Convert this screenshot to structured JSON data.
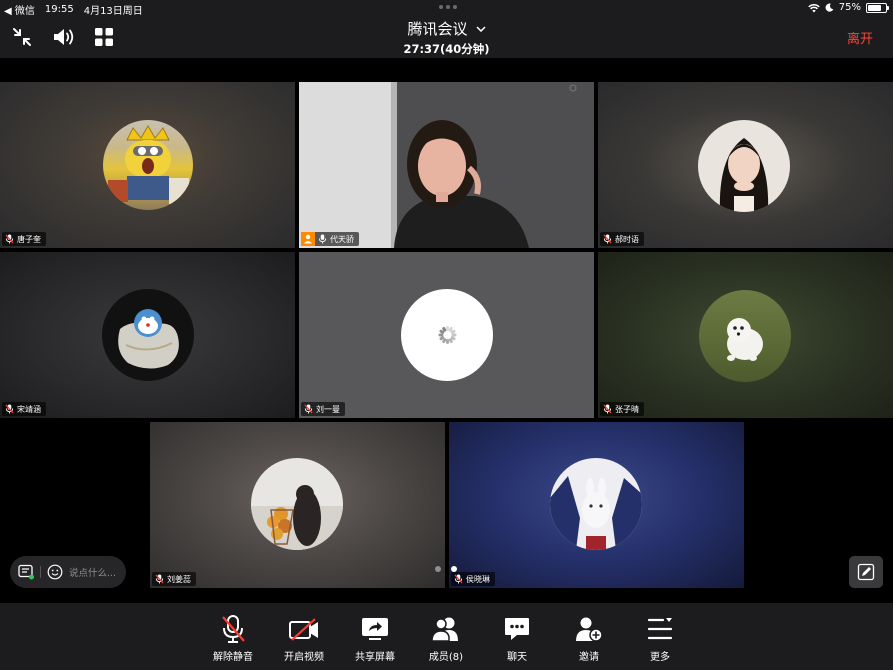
{
  "status_bar": {
    "back_app": "◀ 微信",
    "time": "19:55",
    "date": "4月13日周日",
    "battery": "75%",
    "battery_level": 0.75
  },
  "header": {
    "title": "腾讯会议",
    "duration": "27:37(40分钟)",
    "leave_label": "离开"
  },
  "participants": [
    {
      "name": "唐子奎"
    },
    {
      "name": "代天骄",
      "host": true
    },
    {
      "name": "郝时语"
    },
    {
      "name": "宋靖涵"
    },
    {
      "name": "刘一曼"
    },
    {
      "name": "张子晴"
    },
    {
      "name": "刘姜蕊"
    },
    {
      "name": "侯晓琳"
    }
  ],
  "chat": {
    "placeholder": "说点什么..."
  },
  "toolbar": {
    "items": [
      {
        "label": "解除静音",
        "icon": "mic-muted-icon"
      },
      {
        "label": "开启视频",
        "icon": "video-off-icon"
      },
      {
        "label": "共享屏幕",
        "icon": "share-screen-icon"
      },
      {
        "label": "成员(8)",
        "icon": "members-icon"
      },
      {
        "label": "聊天",
        "icon": "chat-icon"
      },
      {
        "label": "邀请",
        "icon": "invite-icon"
      },
      {
        "label": "更多",
        "icon": "more-icon"
      }
    ]
  },
  "colors": {
    "leave": "#ff453a",
    "host_badge": "#ff8a00",
    "toolbar_bg": "#1c1c1e"
  }
}
